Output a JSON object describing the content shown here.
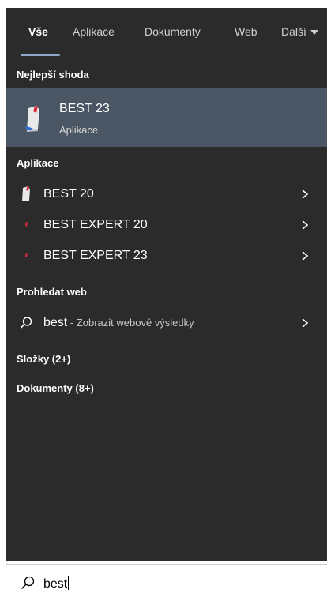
{
  "tabs": [
    {
      "label": "Vše",
      "active": true
    },
    {
      "label": "Aplikace",
      "active": false
    },
    {
      "label": "Dokumenty",
      "active": false
    },
    {
      "label": "Web",
      "active": false
    },
    {
      "label": "Další",
      "active": false
    }
  ],
  "sections": {
    "best_match": "Nejlepší shoda",
    "apps": "Aplikace",
    "web": "Prohledat web",
    "folders": "Složky (2+)",
    "documents": "Dokumenty (8+)"
  },
  "best_match": {
    "title": "BEST 23",
    "subtitle": "Aplikace",
    "icon": "best-app-icon"
  },
  "apps": [
    {
      "label": "BEST 20",
      "icon": "best-app-icon"
    },
    {
      "label": "BEST EXPERT 20",
      "icon": "best-expert-icon"
    },
    {
      "label": "BEST EXPERT 23",
      "icon": "best-expert-icon"
    }
  ],
  "web_result": {
    "query": "best",
    "suffix": " - Zobrazit webové výsledky",
    "icon": "search-icon"
  },
  "search": {
    "value": "best",
    "icon": "search-icon"
  },
  "colors": {
    "panel_bg": "#2b2b2b",
    "selected_bg": "#4a5664",
    "accent_underline": "#8fa6c8",
    "icon_red": "#d9283a",
    "icon_blue": "#2f6fd0"
  }
}
